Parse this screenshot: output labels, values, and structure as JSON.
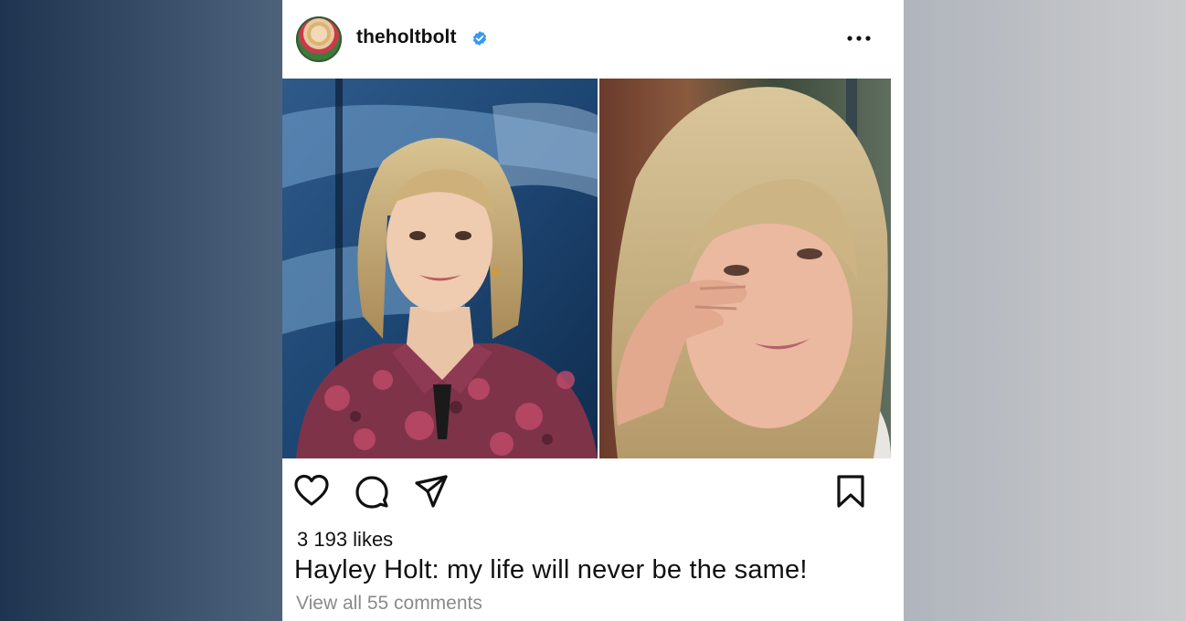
{
  "post": {
    "username": "theholtbolt",
    "likes": "3 193 likes",
    "caption": "Hayley Holt: my life will never be the same!",
    "view_comments": "View all 55 comments"
  },
  "icons": {
    "verified": "verified-badge-icon",
    "more": "more-options-icon",
    "like": "heart-icon",
    "comment": "comment-icon",
    "share": "send-icon",
    "save": "bookmark-icon"
  },
  "colors": {
    "verified_blue": "#3897f0",
    "text": "#111111",
    "secondary_text": "#8a8a8a"
  }
}
